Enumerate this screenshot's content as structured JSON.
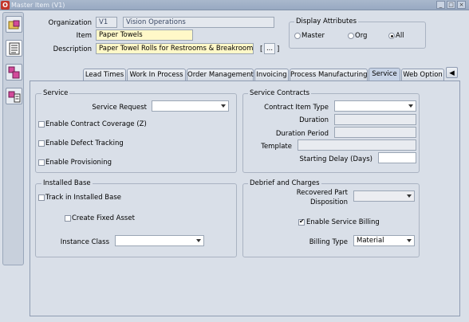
{
  "window": {
    "title": "Master Item (V1)",
    "app_icon": "oracle-icon",
    "buttons": [
      "minimize-icon",
      "maximize-icon",
      "close-icon"
    ]
  },
  "left_icons": [
    "folder-cube-icon",
    "list-icon",
    "stacked-cubes-icon",
    "cube-list-icon"
  ],
  "header": {
    "organization_label": "Organization",
    "organization_code": "V1",
    "organization_name": "Vision Operations",
    "item_label": "Item",
    "item_value": "Paper Towels",
    "description_label": "Description",
    "description_value": "Paper Towel Rolls for Restrooms & Breakrooms",
    "flex_field": "[ ]",
    "flex_button": "..."
  },
  "display_attributes": {
    "title": "Display Attributes",
    "options": [
      {
        "label": "Master",
        "selected": false
      },
      {
        "label": "Org",
        "selected": false
      },
      {
        "label": "All",
        "selected": true
      }
    ]
  },
  "tabs": [
    "Lead Times",
    "Work In Process",
    "Order Management",
    "Invoicing",
    "Process Manufacturing",
    "Service",
    "Web Option"
  ],
  "active_tab": "Service",
  "tab_scroll": "◀",
  "service": {
    "title": "Service",
    "service_request_label": "Service Request",
    "service_request_value": "",
    "enable_contract_coverage": "Enable Contract Coverage (Z)",
    "enable_defect_tracking": "Enable Defect Tracking",
    "enable_provisioning": "Enable Provisioning"
  },
  "service_contracts": {
    "title": "Service Contracts",
    "contract_item_type_label": "Contract Item Type",
    "duration_label": "Duration",
    "duration_period_label": "Duration Period",
    "template_label": "Template",
    "starting_delay_label": "Starting Delay (Days)"
  },
  "installed_base": {
    "title": "Installed Base",
    "track_label": "Track in Installed Base",
    "create_fixed_asset_label": "Create Fixed Asset",
    "instance_class_label": "Instance Class"
  },
  "debrief": {
    "title": "Debrief and Charges",
    "recovered_part_label_1": "Recovered Part",
    "recovered_part_label_2": "Disposition",
    "enable_service_billing_label": "Enable Service Billing",
    "billing_type_label": "Billing Type",
    "billing_type_value": "Material"
  }
}
